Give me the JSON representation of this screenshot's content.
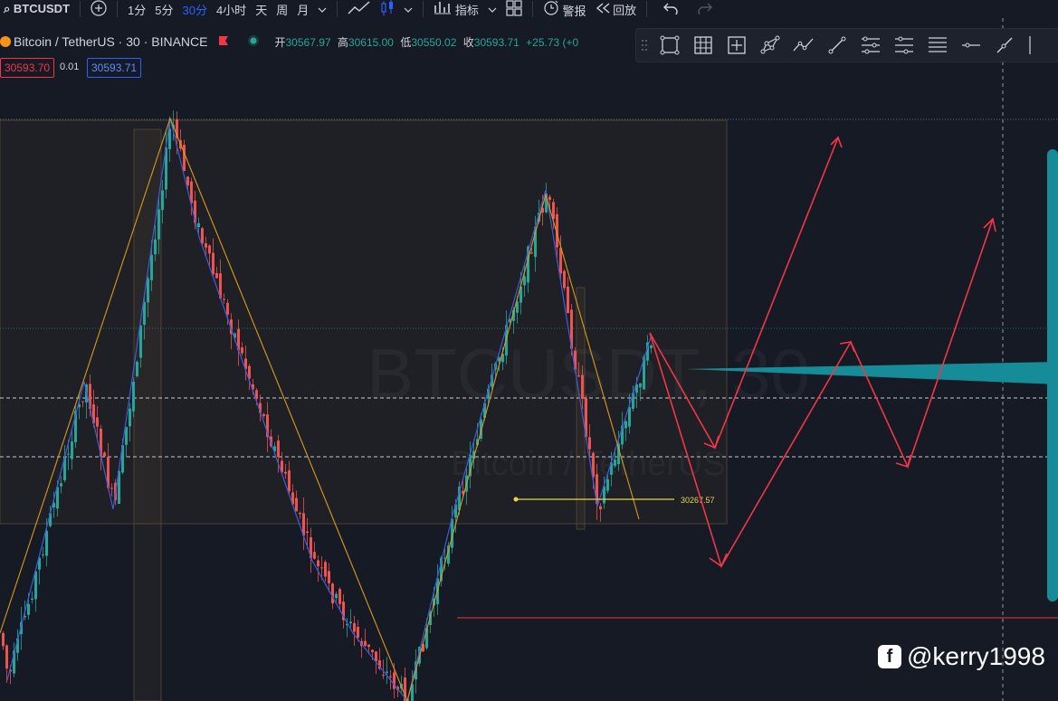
{
  "toolbar": {
    "symbol": "BTCUSDT",
    "intervals": [
      "1分",
      "5分",
      "30分",
      "4小时",
      "天",
      "周",
      "月"
    ],
    "active_interval": "30分",
    "indicators_label": "指标",
    "alert_label": "警报",
    "replay_label": "回放"
  },
  "legend": {
    "title": "Bitcoin / TetherUS · 30 · BINANCE",
    "open_label": "开",
    "open": "30567.97",
    "high_label": "高",
    "high": "30615.00",
    "low_label": "低",
    "low": "30550.02",
    "close_label": "收",
    "close": "30593.71",
    "change": "+25.73 (+0",
    "sell_price": "30593.70",
    "spread": "0.01",
    "buy_price": "30593.71"
  },
  "chart": {
    "horizontal_level_label": "30267.57",
    "watermark_symbol": "BTCUSDT, 30",
    "watermark_name": "Bitcoin / TetherUS",
    "colors": {
      "up": "#26a69a",
      "down": "#ef5350",
      "zigzag_blue": "#3f5bd9",
      "zigzag_orange": "#d99a1a",
      "projection": "#f23645",
      "level_line": "#e8d44d",
      "teal_shape": "#168c99"
    }
  },
  "drawing_tools": [
    "rectangle-icon",
    "grid-icon",
    "crosshair-box-icon",
    "pattern-icon",
    "path-icon",
    "trendline-icon",
    "parallel-channel-icon",
    "pitchfork-icon",
    "horizontal-lines-icon",
    "horizontal-ray-icon",
    "ray-icon"
  ],
  "credit": {
    "handle": "@kerry1998"
  }
}
